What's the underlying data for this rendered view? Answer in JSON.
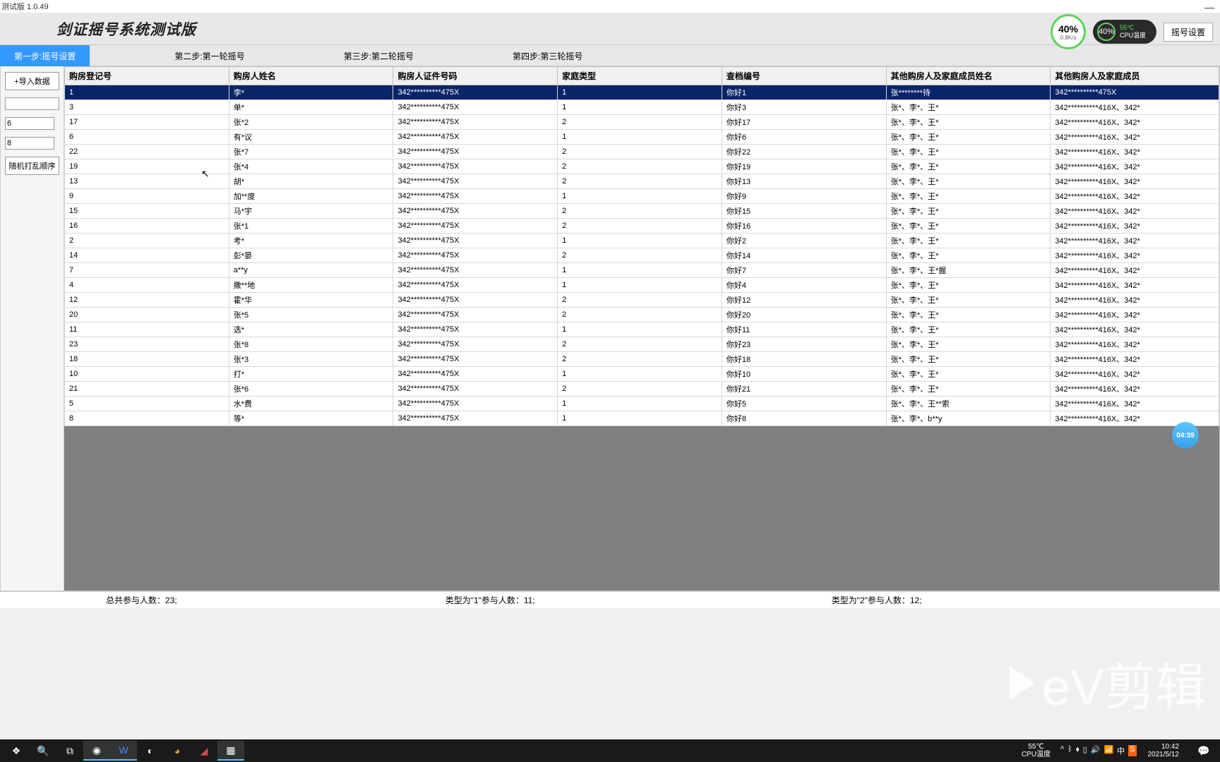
{
  "window": {
    "title": "测试版 1.0.49"
  },
  "header": {
    "app_title": "剑证摇号系统测试版",
    "gauge1": {
      "pct": "40%",
      "rate": "0.8K/s"
    },
    "gauge2": {
      "pct": "40%",
      "temp_val": "55℃",
      "temp_lbl": "CPU温度"
    },
    "settings_btn": "摇号设置"
  },
  "tabs": [
    {
      "label": "第一步:摇号设置",
      "active": true
    },
    {
      "label": "第二步:第一轮摇号",
      "active": false
    },
    {
      "label": "第三步:第二轮摇号",
      "active": false
    },
    {
      "label": "第四步:第三轮摇号",
      "active": false
    }
  ],
  "sidebar": {
    "import_btn": "+导入数据",
    "input1": "",
    "input2": "6",
    "input3": "8",
    "shuffle_btn": "随机打乱顺序"
  },
  "table": {
    "headers": [
      "购房登记号",
      "购房人姓名",
      "购房人证件号码",
      "家庭类型",
      "查档编号",
      "其他购房人及家庭成员姓名",
      "其他购房人及家庭成员"
    ],
    "rows": [
      {
        "c0": "1",
        "c1": "李*",
        "c2": "342**********475X",
        "c3": "1",
        "c4": "你好1",
        "c5": "张********待",
        "c6": "342**********475X",
        "sel": true
      },
      {
        "c0": "3",
        "c1": "单*",
        "c2": "342**********475X",
        "c3": "1",
        "c4": "你好3",
        "c5": "张*、李*、王*",
        "c6": "342**********416X、342*"
      },
      {
        "c0": "17",
        "c1": "张*2",
        "c2": "342**********475X",
        "c3": "2",
        "c4": "你好17",
        "c5": "张*、李*、王*",
        "c6": "342**********416X、342*"
      },
      {
        "c0": "6",
        "c1": "有*议",
        "c2": "342**********475X",
        "c3": "1",
        "c4": "你好6",
        "c5": "张*、李*、王*",
        "c6": "342**********416X、342*"
      },
      {
        "c0": "22",
        "c1": "张*7",
        "c2": "342**********475X",
        "c3": "2",
        "c4": "你好22",
        "c5": "张*、李*、王*",
        "c6": "342**********416X、342*"
      },
      {
        "c0": "19",
        "c1": "张*4",
        "c2": "342**********475X",
        "c3": "2",
        "c4": "你好19",
        "c5": "张*、李*、王*",
        "c6": "342**********416X、342*"
      },
      {
        "c0": "13",
        "c1": "胡*",
        "c2": "342**********475X",
        "c3": "2",
        "c4": "你好13",
        "c5": "张*、李*、王*",
        "c6": "342**********416X、342*"
      },
      {
        "c0": "9",
        "c1": "加**度",
        "c2": "342**********475X",
        "c3": "1",
        "c4": "你好9",
        "c5": "张*、李*、王*",
        "c6": "342**********416X、342*"
      },
      {
        "c0": "15",
        "c1": "马*宇",
        "c2": "342**********475X",
        "c3": "2",
        "c4": "你好15",
        "c5": "张*、李*、王*",
        "c6": "342**********416X、342*"
      },
      {
        "c0": "16",
        "c1": "张*1",
        "c2": "342**********475X",
        "c3": "2",
        "c4": "你好16",
        "c5": "张*、李*、王*",
        "c6": "342**********416X、342*"
      },
      {
        "c0": "2",
        "c1": "考*",
        "c2": "342**********475X",
        "c3": "1",
        "c4": "你好2",
        "c5": "张*、李*、王*",
        "c6": "342**********416X、342*"
      },
      {
        "c0": "14",
        "c1": "彭*晏",
        "c2": "342**********475X",
        "c3": "2",
        "c4": "你好14",
        "c5": "张*、李*、王*",
        "c6": "342**********416X、342*"
      },
      {
        "c0": "7",
        "c1": "a**y",
        "c2": "342**********475X",
        "c3": "1",
        "c4": "你好7",
        "c5": "张*、李*、王*握",
        "c6": "342**********416X、342*"
      },
      {
        "c0": "4",
        "c1": "撒**地",
        "c2": "342**********475X",
        "c3": "1",
        "c4": "你好4",
        "c5": "张*、李*、王*",
        "c6": "342**********416X、342*"
      },
      {
        "c0": "12",
        "c1": "霍*华",
        "c2": "342**********475X",
        "c3": "2",
        "c4": "你好12",
        "c5": "张*、李*、王*",
        "c6": "342**********416X、342*"
      },
      {
        "c0": "20",
        "c1": "张*5",
        "c2": "342**********475X",
        "c3": "2",
        "c4": "你好20",
        "c5": "张*、李*、王*",
        "c6": "342**********416X、342*"
      },
      {
        "c0": "11",
        "c1": "选*",
        "c2": "342**********475X",
        "c3": "1",
        "c4": "你好11",
        "c5": "张*、李*、王*",
        "c6": "342**********416X、342*"
      },
      {
        "c0": "23",
        "c1": "张*8",
        "c2": "342**********475X",
        "c3": "2",
        "c4": "你好23",
        "c5": "张*、李*、王*",
        "c6": "342**********416X、342*"
      },
      {
        "c0": "18",
        "c1": "张*3",
        "c2": "342**********475X",
        "c3": "2",
        "c4": "你好18",
        "c5": "张*、李*、王*",
        "c6": "342**********416X、342*"
      },
      {
        "c0": "10",
        "c1": "打*",
        "c2": "342**********475X",
        "c3": "1",
        "c4": "你好10",
        "c5": "张*、李*、王*",
        "c6": "342**********416X、342*"
      },
      {
        "c0": "21",
        "c1": "张*6",
        "c2": "342**********475X",
        "c3": "2",
        "c4": "你好21",
        "c5": "张*、李*、王*",
        "c6": "342**********416X、342*"
      },
      {
        "c0": "5",
        "c1": "水*费",
        "c2": "342**********475X",
        "c3": "1",
        "c4": "你好5",
        "c5": "张*、李*、王**索",
        "c6": "342**********416X、342*"
      },
      {
        "c0": "8",
        "c1": "等*",
        "c2": "342**********475X",
        "c3": "1",
        "c4": "你好8",
        "c5": "张*、李*、b**y",
        "c6": "342**********416X、342*"
      }
    ]
  },
  "status": {
    "total": "总共参与人数：23;",
    "type1": "类型为\"1\"参与人数：11;",
    "type2": "类型为\"2\"参与人数：12;"
  },
  "float_timer": "04:39",
  "watermark": "eV剪辑",
  "taskbar": {
    "temp_val": "55℃",
    "temp_lbl": "CPU温度",
    "ime": "中",
    "time": "10:42",
    "date": "2021/5/12"
  }
}
